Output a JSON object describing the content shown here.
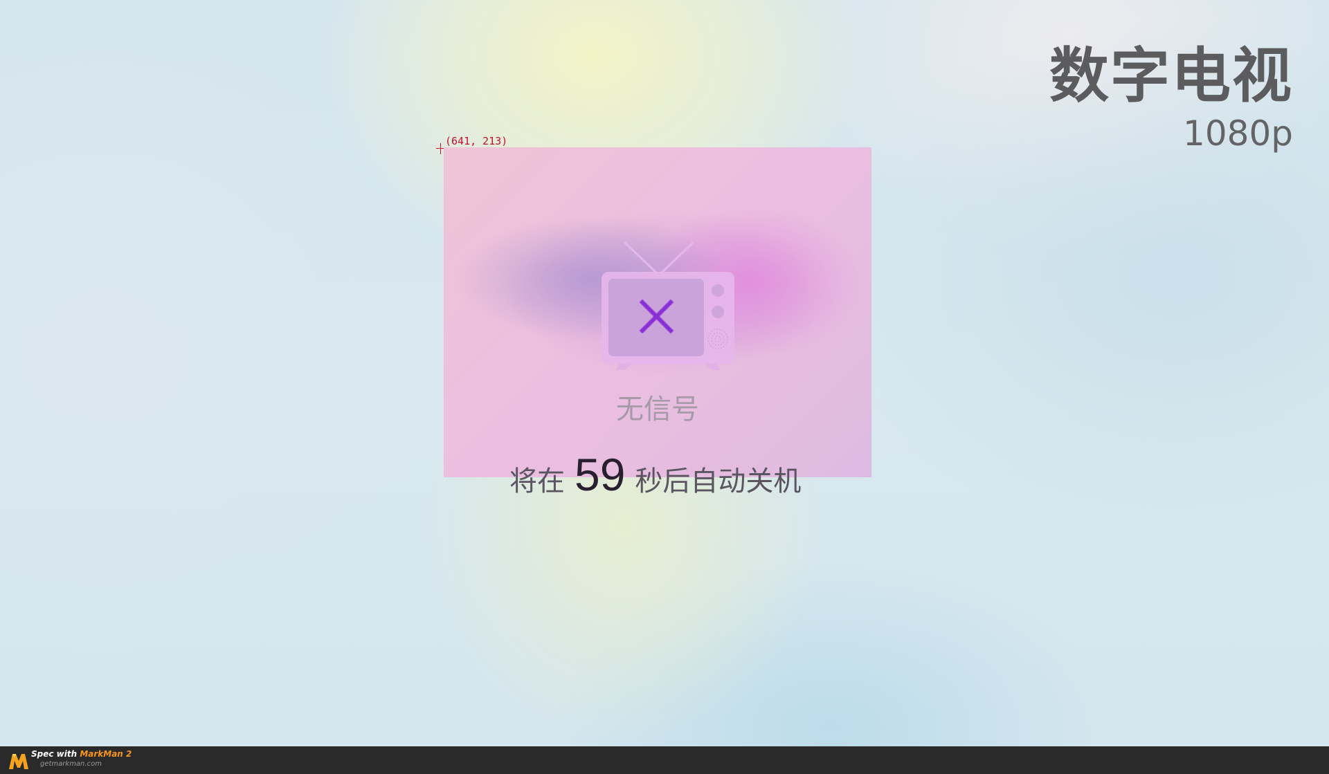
{
  "channel": {
    "name": "数字电视",
    "resolution": "1080p"
  },
  "spec_overlay": {
    "coordinate_label": "(641, 213)"
  },
  "dialog": {
    "icon": "tv-no-signal-icon",
    "status": "无信号",
    "countdown": {
      "prefix": "将在",
      "seconds": "59",
      "suffix": "秒后自动关机"
    }
  },
  "watermark": {
    "line1_prefix": "Spec with",
    "line1_brand": "MarkMan 2",
    "line2": "getmarkman.com"
  },
  "colors": {
    "dialog_pink": "#ecbfe0",
    "x_mark_purple": "#8a2fd6",
    "title_gray": "#5c5c5e",
    "spec_red": "#c0102a",
    "markman_orange": "#f7941e"
  }
}
